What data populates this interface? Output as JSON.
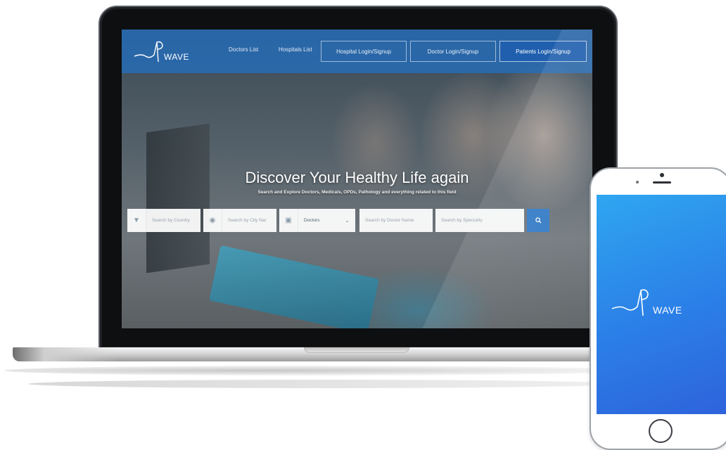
{
  "website": {
    "logo_text": "WAVE",
    "nav": {
      "links": [
        "Doctors List",
        "Hospitals List"
      ],
      "buttons": [
        "Hospital Login/Signup",
        "Doctor Login/Signup",
        "Patients Login/Signup"
      ]
    },
    "hero": {
      "title": "Discover Your Healthy Life again",
      "subtitle": "Search and Explore Doctors, Medicals, OPDs, Pathology and everything related to this field"
    },
    "search": {
      "country_placeholder": "Search by Country",
      "city_placeholder": "Search by City Nar",
      "type_value": "Doctors",
      "name_placeholder": "Search by Doctor Name",
      "speciality_placeholder": "Search by Speciality",
      "button_icon": "search-icon"
    },
    "colors": {
      "nav_bg": "#246ebe",
      "primary_button": "#1f5fae",
      "search_button": "#2f78c4"
    }
  },
  "phone_app": {
    "logo_text": "WAVE",
    "colors": {
      "gradient_start": "#2fa6f0",
      "gradient_end": "#2e63dc"
    }
  }
}
